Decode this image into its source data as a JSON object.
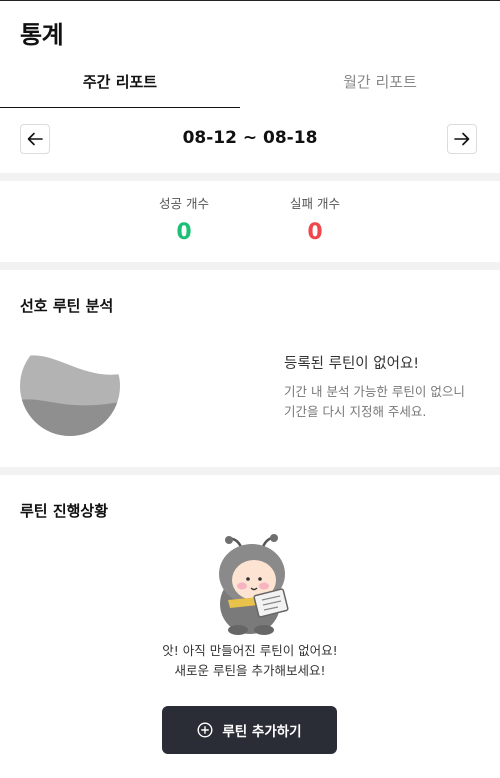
{
  "header": {
    "title": "통계"
  },
  "tabs": [
    {
      "label": "주간 리포트",
      "active": true
    },
    {
      "label": "월간 리포트",
      "active": false
    }
  ],
  "date_nav": {
    "range": "08-12 ~ 08-18",
    "prev_icon": "arrow-left-icon",
    "next_icon": "arrow-right-icon"
  },
  "counts": {
    "success_label": "성공 개수",
    "success_value": "0",
    "success_color": "#1cbf73",
    "fail_label": "실패 개수",
    "fail_value": "0",
    "fail_color": "#f0474c"
  },
  "preferred": {
    "title": "선호 루틴 분석",
    "empty_title": "등록된 루틴이 없어요!",
    "empty_desc_line1": "기간 내 분석 가능한 루틴이 없으니",
    "empty_desc_line2": "기간을 다시 지정해 주세요."
  },
  "progress": {
    "title": "루틴 진행상황",
    "empty_line1": "앗! 아직 만들어진 루틴이 없어요!",
    "empty_line2": "새로운 루틴을 추가해보세요!",
    "button_label": "루틴 추가하기",
    "button_icon": "plus-circle-icon"
  }
}
